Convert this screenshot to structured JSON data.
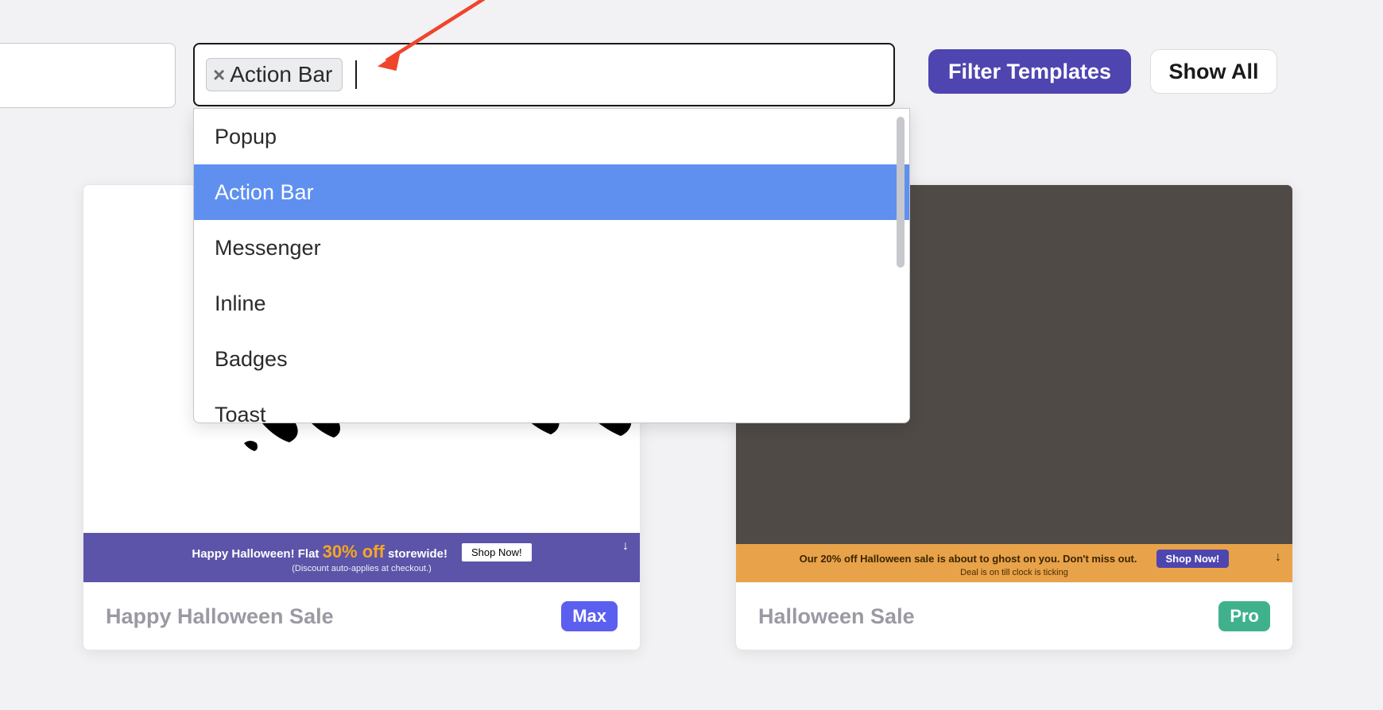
{
  "filter_bar": {
    "selected_chip": "Action Bar",
    "filter_button": "Filter Templates",
    "show_all_button": "Show All"
  },
  "dropdown": {
    "options": [
      "Popup",
      "Action Bar",
      "Messenger",
      "Inline",
      "Badges",
      "Toast"
    ],
    "selected": "Action Bar"
  },
  "cards": [
    {
      "title": "Happy Halloween Sale",
      "badge": "Max",
      "banner_bg": "purple",
      "banner_line1_pre": "Happy Halloween! Flat",
      "banner_discount": "30% off",
      "banner_line1_post": "storewide!",
      "banner_btn": "Shop Now!",
      "banner_sub": "(Discount auto-applies at checkout.)"
    },
    {
      "title": "Halloween Sale",
      "badge": "Pro",
      "banner_bg": "orange",
      "banner_line1": "Our 20% off Halloween sale is about to ghost on you. Don't miss out.",
      "banner_btn": "Shop Now!",
      "banner_sub": "Deal is on till clock is ticking"
    }
  ]
}
